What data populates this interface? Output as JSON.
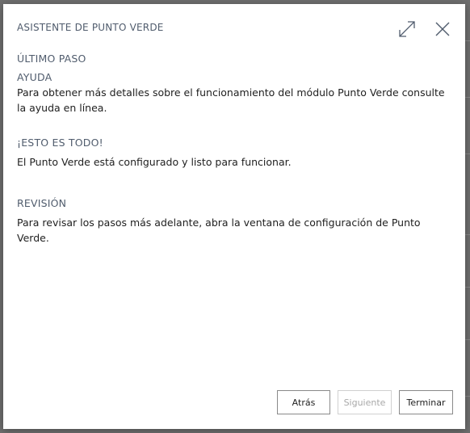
{
  "dialog": {
    "title": "ASISTENTE DE PUNTO VERDE",
    "expand_icon": "expand-icon",
    "close_icon": "close-icon"
  },
  "content": {
    "step_heading": "ÚLTIMO PASO",
    "help_heading": "AYUDA",
    "help_text": "Para obtener más detalles sobre el funcionamiento del módulo Punto Verde consulte la ayuda en línea.",
    "done_heading": "¡ESTO ES TODO!",
    "done_text": "El Punto Verde está configurado y listo para funcionar.",
    "review_heading": "REVISIÓN",
    "review_text": "Para revisar los pasos más adelante, abra la ventana de configuración de Punto Verde."
  },
  "footer": {
    "back_label": "Atrás",
    "next_label": "Siguiente",
    "finish_label": "Terminar"
  },
  "colors": {
    "heading": "#505c6d",
    "text": "#212121",
    "border": "#8a8a8a",
    "disabled": "#a8a8a8"
  }
}
